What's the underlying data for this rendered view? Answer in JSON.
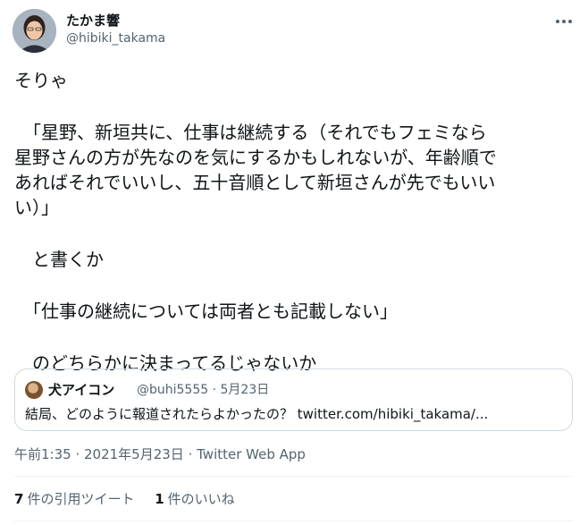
{
  "author": {
    "name": "たかま響",
    "handle": "@hibiki_takama"
  },
  "more_icon": "more-horizontal-icon",
  "body_lines": [
    "そりゃ",
    "",
    "　「星野、新垣共に、仕事は継続する（それでもフェミなら",
    "星野さんの方が先なのを気にするかもしれないが、年齢順で",
    "あればそれでいいし、五十音順として新垣さんが先でもいい",
    "い）」",
    "",
    "　と書くか",
    "",
    "　「仕事の継続については両者とも記載しない」",
    "",
    "　のどちらかに決まってるじゃないか"
  ],
  "quoted_tweet": {
    "name": "犬アイコン",
    "meta": "@buhi5555 · 5月23日",
    "text": "結局、どのように報道されたらよかったの？ twitter.com/hibiki_takama/..."
  },
  "timestamp": {
    "time": "午前1:35",
    "date": "2021年5月23日",
    "source": "Twitter Web App",
    "separator": " · "
  },
  "stats": {
    "quote_count": "7",
    "quote_label": "件の引用ツイート",
    "like_count": "1",
    "like_label": "件のいいね"
  },
  "colors": {
    "text": "#0f1419",
    "secondary": "#536471",
    "border": "#cfd9de",
    "divider": "#eff3f4"
  }
}
